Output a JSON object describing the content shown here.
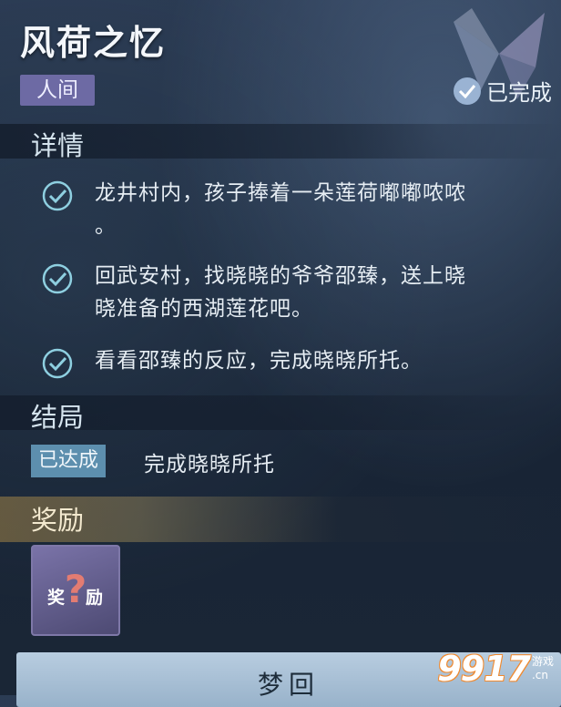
{
  "quest": {
    "title": "风荷之忆",
    "category": "人间",
    "status": "已完成"
  },
  "details": {
    "heading": "详情",
    "items": [
      {
        "lines": [
          "龙井村内，孩子捧着一朵莲荷嘟嘟哝哝",
          "。"
        ]
      },
      {
        "lines": [
          "回武安村，找晓晓的爷爷邵臻，送上晓",
          "晓准备的西湖莲花吧。"
        ]
      },
      {
        "lines": [
          "看看邵臻的反应，完成晓晓所托。"
        ]
      }
    ]
  },
  "ending": {
    "heading": "结局",
    "badge": "已达成",
    "text": "完成晓晓所托"
  },
  "reward": {
    "heading": "奖励",
    "item_label_left": "奖",
    "item_label_right": "励",
    "item_symbol": "?"
  },
  "action": {
    "button_label": "梦回"
  },
  "watermark": {
    "number": "9917",
    "line1": "游戏",
    "line2": ".cn"
  },
  "colors": {
    "accent_tag": "#6d6aa4",
    "badge": "#5d8fae",
    "button": "#a9c1d7"
  }
}
